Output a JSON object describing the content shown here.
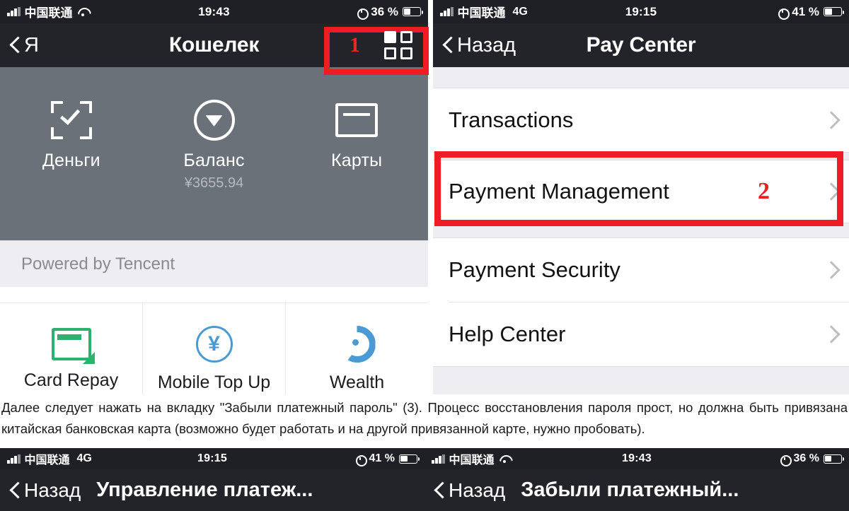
{
  "left_phone": {
    "status_bar": {
      "carrier": "中国联通",
      "network": "",
      "time": "19:43",
      "battery_percent": "36 %",
      "signal_icon": "signal-bars-icon",
      "wifi_icon": "wifi-icon",
      "alarm_icon": "alarm-clock-icon",
      "battery_icon": "battery-icon"
    },
    "nav": {
      "back_label": "Я",
      "title": "Кошелек",
      "grid_icon": "grid-icon",
      "marker": "1"
    },
    "wallet_card": [
      {
        "icon": "scan-qr-icon",
        "label": "Деньги",
        "sub": ""
      },
      {
        "icon": "balance-diamond-icon",
        "label": "Баланс",
        "sub": "¥3655.94"
      },
      {
        "icon": "bank-card-icon",
        "label": "Карты",
        "sub": ""
      }
    ],
    "powered_by": "Powered by Tencent",
    "quick_actions": [
      {
        "icon": "card-repay-icon",
        "label": "Card Repay"
      },
      {
        "icon": "yuan-circle-icon",
        "label": "Mobile Top Up"
      },
      {
        "icon": "wealth-icon",
        "label": "Wealth"
      }
    ]
  },
  "right_phone": {
    "status_bar": {
      "carrier": "中国联通",
      "network": "4G",
      "time": "19:15",
      "battery_percent": "41 %",
      "signal_icon": "signal-bars-icon",
      "alarm_icon": "alarm-clock-icon",
      "battery_icon": "battery-icon"
    },
    "nav": {
      "back_label": "Назад",
      "title": "Pay Center"
    },
    "menu_items": [
      {
        "label": "Transactions",
        "chevron": "chevron-right-icon"
      },
      {
        "label": "Payment Management",
        "chevron": "chevron-right-icon",
        "marker": "2"
      },
      {
        "label": "Payment Security",
        "chevron": "chevron-right-icon"
      },
      {
        "label": "Help Center",
        "chevron": "chevron-right-icon"
      }
    ]
  },
  "caption": {
    "text": "Далее следует нажать на вкладку \"Забыли платежный пароль\" (3). Процесс восстановления пароля прост, но должна быть привязана китайская банковская карта (возможно будет работать и на другой привязанной карте, нужно пробовать)."
  },
  "bottom_left_phone": {
    "status_bar": {
      "carrier": "中国联通",
      "network": "4G",
      "time": "19:15",
      "battery_percent": "41 %"
    },
    "nav": {
      "back_label": "Назад",
      "title": "Управление платеж..."
    }
  },
  "bottom_right_phone": {
    "status_bar": {
      "carrier": "中国联通",
      "network": "",
      "time": "19:43",
      "battery_percent": "36 %"
    },
    "nav": {
      "back_label": "Назад",
      "title": "Забыли платежный..."
    }
  },
  "colors": {
    "accent_red": "#ee1c25",
    "card_grey": "#6b7179",
    "band_grey": "#eeedf2",
    "nav_dark": "#232429",
    "green": "#2bb26c",
    "blue": "#4a9ad4"
  }
}
